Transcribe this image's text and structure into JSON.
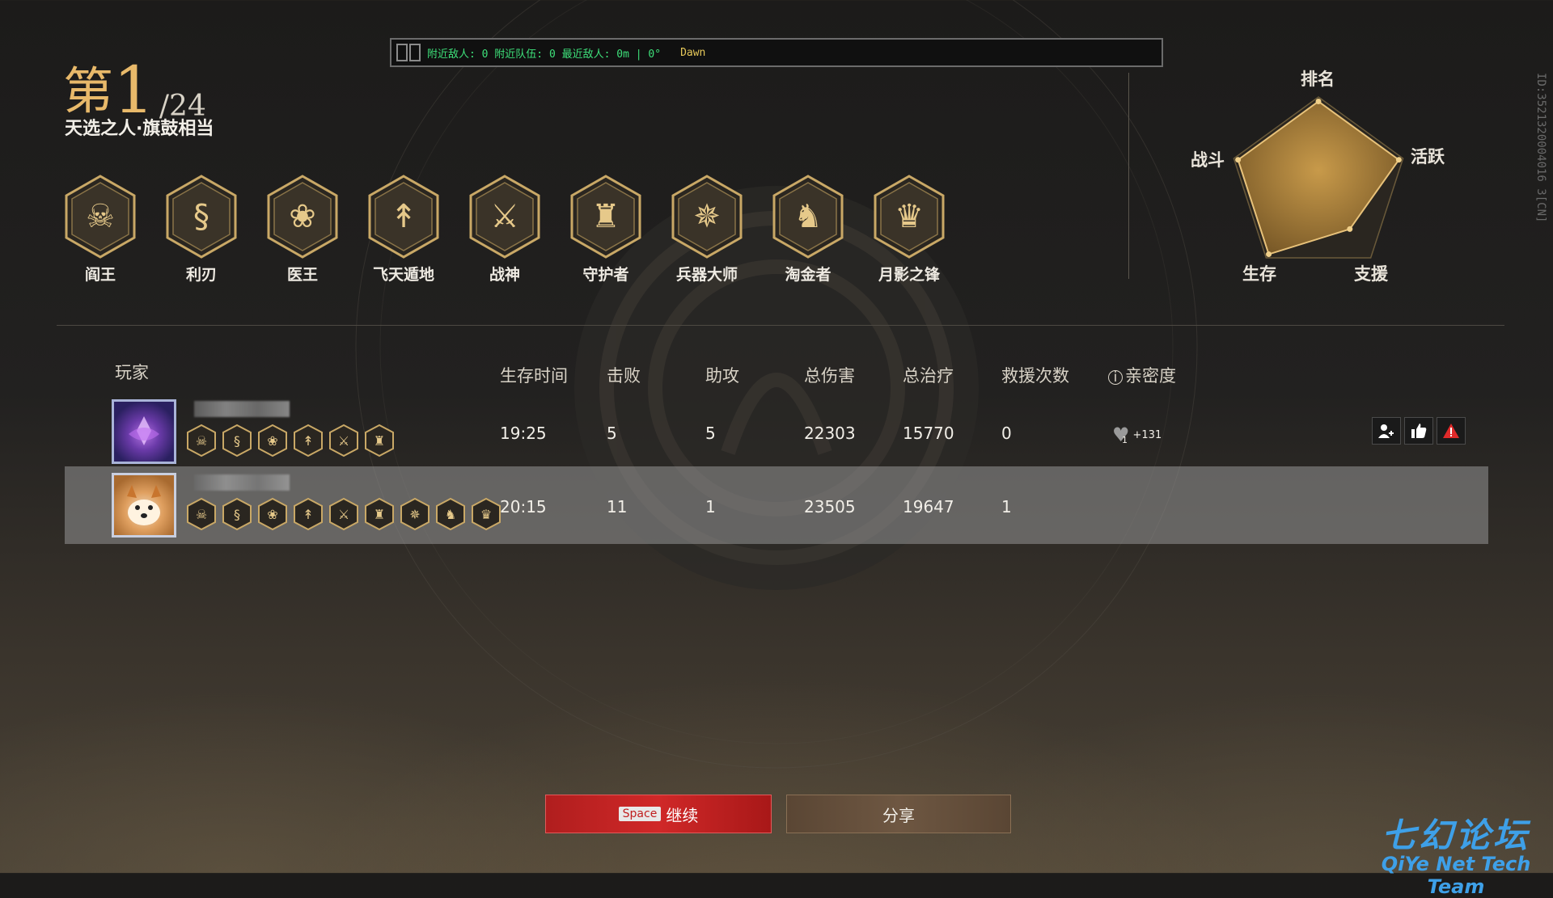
{
  "status_bar": {
    "text": "附近敌人: 0  附近队伍: 0  最近敌人: 0m | 0°",
    "time": "Dawn"
  },
  "rank": {
    "prefix": "第",
    "position": "1",
    "total": "/24",
    "title": "天选之人·旗鼓相当"
  },
  "achievements": [
    {
      "label": "阎王",
      "icon": "oni-mask-icon"
    },
    {
      "label": "利刃",
      "icon": "coiled-blade-icon"
    },
    {
      "label": "医王",
      "icon": "lotus-hand-icon"
    },
    {
      "label": "飞天遁地",
      "icon": "grappling-hook-icon"
    },
    {
      "label": "战神",
      "icon": "sword-wings-icon"
    },
    {
      "label": "守护者",
      "icon": "guardian-icon"
    },
    {
      "label": "兵器大师",
      "icon": "crossed-weapons-icon"
    },
    {
      "label": "淘金者",
      "icon": "treasure-hunter-icon"
    },
    {
      "label": "月影之锋",
      "icon": "moon-shadow-icon"
    }
  ],
  "radar": {
    "labels": {
      "top": "排名",
      "right": "活跃",
      "bottom_right": "支援",
      "bottom_left": "生存",
      "left": "战斗"
    },
    "values": {
      "top": 0.95,
      "right": 0.95,
      "bottom_right": 0.6,
      "bottom_left": 0.95,
      "left": 0.95
    }
  },
  "table": {
    "headers": {
      "player": "玩家",
      "survival_time": "生存时间",
      "kills": "击败",
      "assists": "助攻",
      "damage": "总伤害",
      "healing": "总治疗",
      "rescues": "救援次数",
      "intimacy": "亲密度"
    },
    "rows": [
      {
        "survival_time": "19:25",
        "kills": "5",
        "assists": "5",
        "damage": "22303",
        "healing": "15770",
        "rescues": "0",
        "intimacy_level": "1",
        "intimacy_gain": "+131",
        "badge_count": 6
      },
      {
        "survival_time": "20:15",
        "kills": "11",
        "assists": "1",
        "damage": "23505",
        "healing": "19647",
        "rescues": "1",
        "badge_count": 9
      }
    ]
  },
  "buttons": {
    "continue_key": "Space",
    "continue": "继续",
    "share": "分享"
  },
  "id_text": "ID:3521320004016 3[CN]",
  "watermark": {
    "line1": "七幻论坛",
    "line2": "QiYe Net Tech Team"
  }
}
